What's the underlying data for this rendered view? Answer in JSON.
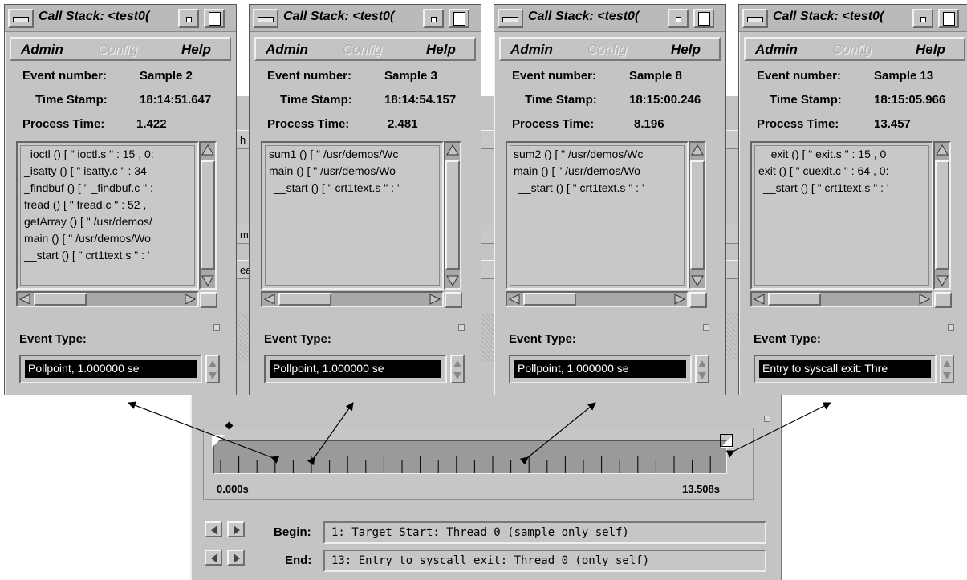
{
  "background_window": {
    "fragments": [
      "h",
      "m",
      "ea",
      "ol",
      "n",
      "ol"
    ],
    "timeline": {
      "start_label": "0.000s",
      "end_label": "13.508s"
    },
    "begin": {
      "label": "Begin:",
      "value": "1: Target Start: Thread 0 (sample only self)"
    },
    "end": {
      "label": "End:",
      "value": "13: Entry to syscall exit: Thread 0 (only self)"
    }
  },
  "windows": [
    {
      "title": "Call Stack: <test0(",
      "menu": {
        "admin": "Admin",
        "config": "Config",
        "help": "Help"
      },
      "event_number_label": "Event number:",
      "event_number": "Sample 2",
      "time_stamp_label": "Time Stamp:",
      "time_stamp": "18:14:51.647",
      "process_time_label": "Process Time:",
      "process_time": "1.422",
      "stack": [
        "_ioctl () [ \" ioctl.s \" : 15 , 0:",
        "_isatty () [ \" isatty.c \" : 34",
        "_findbuf () [ \" _findbuf.c \" :",
        "fread () [ \" fread.c \" : 52 ,",
        "getArray () [ \" /usr/demos/",
        "main () [ \" /usr/demos/Wo",
        "__start () [ \" crt1text.s \" : '"
      ],
      "event_type_label": "Event Type:",
      "event_type": "Pollpoint,     1.000000  se"
    },
    {
      "title": "Call Stack: <test0(",
      "menu": {
        "admin": "Admin",
        "config": "Config",
        "help": "Help"
      },
      "event_number_label": "Event number:",
      "event_number": "Sample 3",
      "time_stamp_label": "Time Stamp:",
      "time_stamp": "18:14:54.157",
      "process_time_label": "Process Time:",
      "process_time": "2.481",
      "stack": [
        "sum1 () [ \" /usr/demos/Wc",
        "main () [ \" /usr/demos/Wo",
        "__start () [ \" crt1text.s \" : '"
      ],
      "event_type_label": "Event Type:",
      "event_type": "Pollpoint,     1.000000  se"
    },
    {
      "title": "Call Stack: <test0(",
      "menu": {
        "admin": "Admin",
        "config": "Config",
        "help": "Help"
      },
      "event_number_label": "Event number:",
      "event_number": "Sample 8",
      "time_stamp_label": "Time Stamp:",
      "time_stamp": "18:15:00.246",
      "process_time_label": "Process Time:",
      "process_time": "8.196",
      "stack": [
        "sum2 () [ \" /usr/demos/Wc",
        "main () [ \" /usr/demos/Wo",
        "__start () [ \" crt1text.s \" : '"
      ],
      "event_type_label": "Event Type:",
      "event_type": "Pollpoint,     1.000000  se"
    },
    {
      "title": "Call Stack: <test0(",
      "menu": {
        "admin": "Admin",
        "config": "Config",
        "help": "Help"
      },
      "event_number_label": "Event number:",
      "event_number": "Sample 13",
      "time_stamp_label": "Time Stamp:",
      "time_stamp": "18:15:05.966",
      "process_time_label": "Process Time:",
      "process_time": "13.457",
      "stack": [
        "__exit () [ \" exit.s \" : 15 , 0",
        "exit () [ \" cuexit.c \" : 64 , 0:",
        "__start () [ \" crt1text.s \" : '"
      ],
      "event_type_label": "Event Type:",
      "event_type": "Entry to syscall exit: Thre"
    }
  ]
}
